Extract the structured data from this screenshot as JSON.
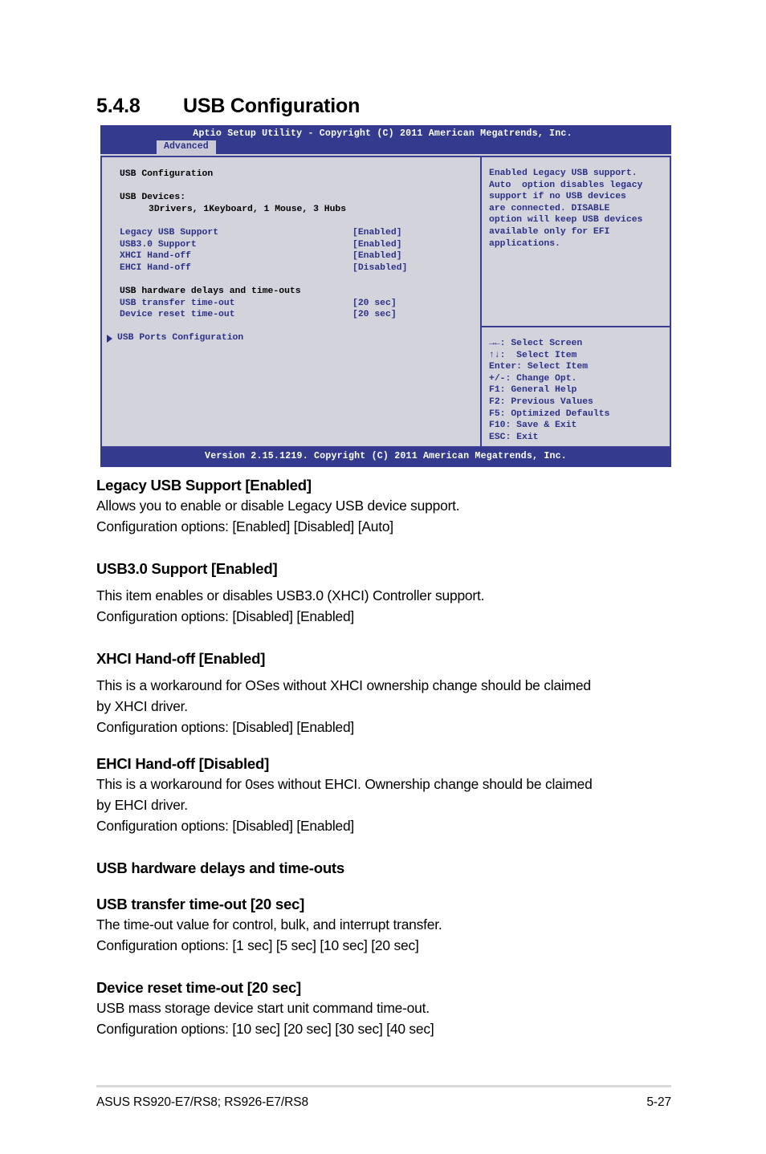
{
  "section": {
    "number": "5.4.8",
    "title": "USB Configuration"
  },
  "bios": {
    "titlebar": "Aptio Setup Utility - Copyright (C) 2011 American Megatrends, Inc.",
    "active_tab": "Advanced",
    "screen_title": "USB Configuration",
    "devices_label": "USB Devices:",
    "devices_value": "3Drivers, 1Keyboard, 1 Mouse, 3 Hubs",
    "settings": [
      {
        "label": "Legacy USB Support",
        "value": "[Enabled]"
      },
      {
        "label": "USB3.0 Support",
        "value": "[Enabled]"
      },
      {
        "label": "XHCI Hand-off",
        "value": "[Enabled]"
      },
      {
        "label": "EHCI Hand-off",
        "value": "[Disabled]"
      }
    ],
    "group_heading": "USB hardware delays and time-outs",
    "timeouts": [
      {
        "label": "USB transfer time-out",
        "value": "[20 sec]"
      },
      {
        "label": "Device reset time-out",
        "value": "[20 sec]"
      }
    ],
    "submenu": "USB Ports Configuration",
    "help_lines": [
      "Enabled Legacy USB support.",
      "Auto  option disables legacy",
      "support if no USB devices",
      "are connected. DISABLE",
      "option will keep USB devices",
      "available only for EFI",
      "applications."
    ],
    "nav_lines": [
      "→←: Select Screen",
      "↑↓:  Select Item",
      "Enter: Select Item",
      "+/-: Change Opt.",
      "F1: General Help",
      "F2: Previous Values",
      "F5: Optimized Defaults",
      "F10: Save & Exit",
      "ESC: Exit"
    ],
    "footer": "Version 2.15.1219. Copyright (C) 2011 American Megatrends, Inc.",
    "colors": {
      "bar": "#343b8e",
      "panel": "#d3d3dc",
      "text": "#2b3188",
      "border": "#3b3f93",
      "tab_bg": "#c9c9d6"
    }
  },
  "prose": {
    "items": [
      {
        "heading": "Legacy USB Support [Enabled]",
        "lines": [
          "Allows you to enable or disable Legacy USB device support.",
          "Configuration options: [Enabled] [Disabled] [Auto]"
        ]
      },
      {
        "heading": "USB3.0 Support [Enabled]",
        "lines": [
          "This item enables or disables USB3.0 (XHCI) Controller support.",
          "Configuration options: [Disabled] [Enabled]"
        ]
      },
      {
        "heading": "XHCI Hand-off [Enabled]",
        "lines": [
          "This is a workaround for OSes without XHCI ownership change should be claimed",
          "by XHCI driver.",
          "Configuration options: [Disabled] [Enabled]"
        ]
      },
      {
        "heading": "EHCI Hand-off [Disabled]",
        "lines": [
          "This is a workaround for 0ses without EHCI. Ownership change should be claimed",
          "by EHCI driver.",
          "Configuration options: [Disabled] [Enabled]"
        ]
      },
      {
        "heading": "USB hardware delays and time-outs",
        "lines": []
      },
      {
        "heading": "USB transfer time-out [20 sec]",
        "lines": [
          "The time-out value for control, bulk, and interrupt transfer.",
          "Configuration options: [1 sec] [5 sec] [10 sec] [20 sec]"
        ]
      },
      {
        "heading": "Device reset time-out [20 sec]",
        "lines": [
          "USB mass storage device start unit command time-out.",
          "Configuration options: [10 sec] [20 sec] [30 sec] [40 sec]"
        ]
      }
    ]
  },
  "footer": {
    "left": "ASUS RS920-E7/RS8; RS926-E7/RS8",
    "page": "5-27"
  }
}
